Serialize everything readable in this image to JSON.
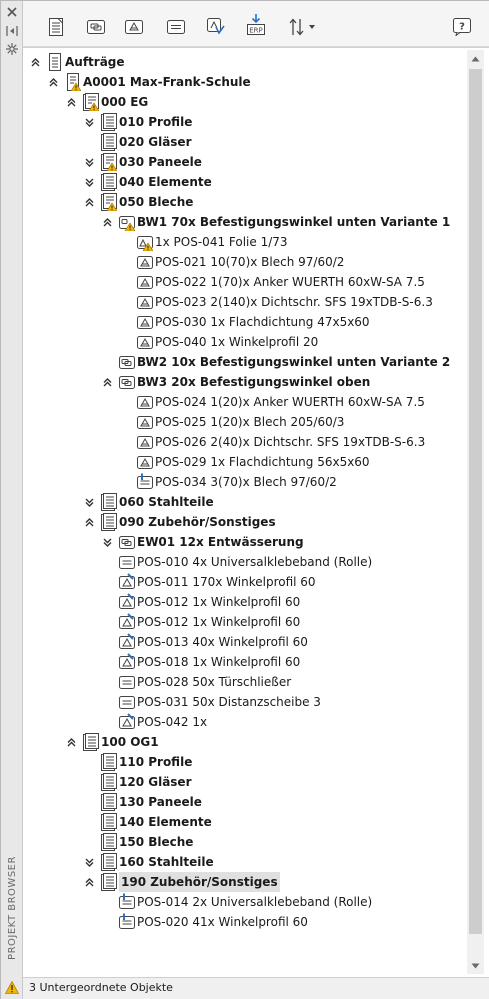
{
  "side_rail": {
    "label": "PROJEKT BROWSER",
    "icons": [
      "close-icon",
      "collapse-panel-icon",
      "gear-icon",
      "warning-icon"
    ]
  },
  "toolbar": {
    "buttons": [
      "document-list-icon",
      "component-icon",
      "part-icon",
      "material-icon",
      "check-icon",
      "erp-export-icon",
      "sort-icon",
      "help-icon"
    ],
    "erp_label": "ERP"
  },
  "tree": [
    {
      "label": "Aufträge",
      "level": 0,
      "bold": true,
      "expand": "expanded",
      "icon": "doc"
    },
    {
      "label": "A0001 Max-Frank-Schule",
      "level": 1,
      "bold": true,
      "expand": "expanded",
      "icon": "doc-warn"
    },
    {
      "label": "000 EG",
      "level": 2,
      "bold": true,
      "expand": "expanded",
      "icon": "group-warn"
    },
    {
      "label": "010 Profile",
      "level": 3,
      "bold": true,
      "expand": "collapsed",
      "icon": "group"
    },
    {
      "label": "020 Gläser",
      "level": 3,
      "bold": true,
      "expand": "none",
      "icon": "group"
    },
    {
      "label": "030 Paneele",
      "level": 3,
      "bold": true,
      "expand": "collapsed",
      "icon": "group-warn"
    },
    {
      "label": "040 Elemente",
      "level": 3,
      "bold": true,
      "expand": "collapsed",
      "icon": "group"
    },
    {
      "label": "050 Bleche",
      "level": 3,
      "bold": true,
      "expand": "expanded",
      "icon": "group-warn"
    },
    {
      "label": "BW1 70x Befestigungswinkel unten Variante 1",
      "level": 4,
      "bold": true,
      "expand": "expanded",
      "icon": "assembly-warn"
    },
    {
      "label": "1x POS-041 Folie 1/73",
      "level": 5,
      "bold": false,
      "expand": "none",
      "icon": "part-warn"
    },
    {
      "label": "POS-021 10(70)x Blech 97/60/2",
      "level": 5,
      "bold": false,
      "expand": "none",
      "icon": "part"
    },
    {
      "label": "POS-022 1(70)x Anker WUERTH 60xW-SA 7.5",
      "level": 5,
      "bold": false,
      "expand": "none",
      "icon": "part"
    },
    {
      "label": "POS-023 2(140)x Dichtschr. SFS 19xTDB-S-6.3",
      "level": 5,
      "bold": false,
      "expand": "none",
      "icon": "part"
    },
    {
      "label": "POS-030 1x Flachdichtung 47x5x60",
      "level": 5,
      "bold": false,
      "expand": "none",
      "icon": "part"
    },
    {
      "label": "POS-040 1x Winkelprofil 20",
      "level": 5,
      "bold": false,
      "expand": "none",
      "icon": "part"
    },
    {
      "label": "BW2 10x Befestigungswinkel unten Variante 2",
      "level": 4,
      "bold": true,
      "expand": "none",
      "icon": "assembly"
    },
    {
      "label": "BW3 20x Befestigungswinkel oben",
      "level": 4,
      "bold": true,
      "expand": "expanded",
      "icon": "assembly"
    },
    {
      "label": "POS-024 1(20)x Anker WUERTH 60xW-SA 7.5",
      "level": 5,
      "bold": false,
      "expand": "none",
      "icon": "part"
    },
    {
      "label": "POS-025 1(20)x Blech 205/60/3",
      "level": 5,
      "bold": false,
      "expand": "none",
      "icon": "part"
    },
    {
      "label": "POS-026 2(40)x Dichtschr. SFS 19xTDB-S-6.3",
      "level": 5,
      "bold": false,
      "expand": "none",
      "icon": "part"
    },
    {
      "label": "POS-029 1x Flachdichtung 56x5x60",
      "level": 5,
      "bold": false,
      "expand": "none",
      "icon": "part"
    },
    {
      "label": "POS-034 3(70)x Blech 97/60/2",
      "level": 5,
      "bold": false,
      "expand": "none",
      "icon": "profile"
    },
    {
      "label": "060 Stahlteile",
      "level": 3,
      "bold": true,
      "expand": "collapsed",
      "icon": "group"
    },
    {
      "label": "090 Zubehör/Sonstiges",
      "level": 3,
      "bold": true,
      "expand": "expanded",
      "icon": "group"
    },
    {
      "label": "EW01 12x Entwässerung",
      "level": 4,
      "bold": true,
      "expand": "collapsed",
      "icon": "assembly"
    },
    {
      "label": "POS-010 4x Universalklebeband (Rolle)",
      "level": 4,
      "bold": false,
      "expand": "none",
      "icon": "material"
    },
    {
      "label": "POS-011 170x Winkelprofil 60",
      "level": 4,
      "bold": false,
      "expand": "none",
      "icon": "part-edit"
    },
    {
      "label": "POS-012 1x Winkelprofil 60",
      "level": 4,
      "bold": false,
      "expand": "none",
      "icon": "part-edit"
    },
    {
      "label": "POS-012 1x Winkelprofil 60",
      "level": 4,
      "bold": false,
      "expand": "none",
      "icon": "part-edit"
    },
    {
      "label": "POS-013 40x Winkelprofil 60",
      "level": 4,
      "bold": false,
      "expand": "none",
      "icon": "part-edit"
    },
    {
      "label": "POS-018 1x Winkelprofil 60",
      "level": 4,
      "bold": false,
      "expand": "none",
      "icon": "part-edit"
    },
    {
      "label": "POS-028 50x Türschließer",
      "level": 4,
      "bold": false,
      "expand": "none",
      "icon": "material"
    },
    {
      "label": "POS-031 50x Distanzscheibe 3",
      "level": 4,
      "bold": false,
      "expand": "none",
      "icon": "material"
    },
    {
      "label": "POS-042 1x",
      "level": 4,
      "bold": false,
      "expand": "none",
      "icon": "part-edit"
    },
    {
      "label": "100 OG1",
      "level": 2,
      "bold": true,
      "expand": "expanded",
      "icon": "group"
    },
    {
      "label": "110 Profile",
      "level": 3,
      "bold": true,
      "expand": "none",
      "icon": "group"
    },
    {
      "label": "120 Gläser",
      "level": 3,
      "bold": true,
      "expand": "none",
      "icon": "group"
    },
    {
      "label": "130 Paneele",
      "level": 3,
      "bold": true,
      "expand": "none",
      "icon": "group"
    },
    {
      "label": "140 Elemente",
      "level": 3,
      "bold": true,
      "expand": "none",
      "icon": "group"
    },
    {
      "label": "150 Bleche",
      "level": 3,
      "bold": true,
      "expand": "none",
      "icon": "group"
    },
    {
      "label": "160 Stahlteile",
      "level": 3,
      "bold": true,
      "expand": "collapsed",
      "icon": "group"
    },
    {
      "label": "190 Zubehör/Sonstiges",
      "level": 3,
      "bold": true,
      "expand": "expanded",
      "icon": "group",
      "selected": true
    },
    {
      "label": "POS-014 2x Universalklebeband (Rolle)",
      "level": 4,
      "bold": false,
      "expand": "none",
      "icon": "profile"
    },
    {
      "label": "POS-020 41x Winkelprofil 60",
      "level": 4,
      "bold": false,
      "expand": "none",
      "icon": "profile"
    }
  ],
  "status_bar": {
    "text": "3 Untergeordnete Objekte"
  },
  "colors": {
    "warning": "#f2b705",
    "accent": "#2a6fc9",
    "selection": "#e0e0e0"
  }
}
